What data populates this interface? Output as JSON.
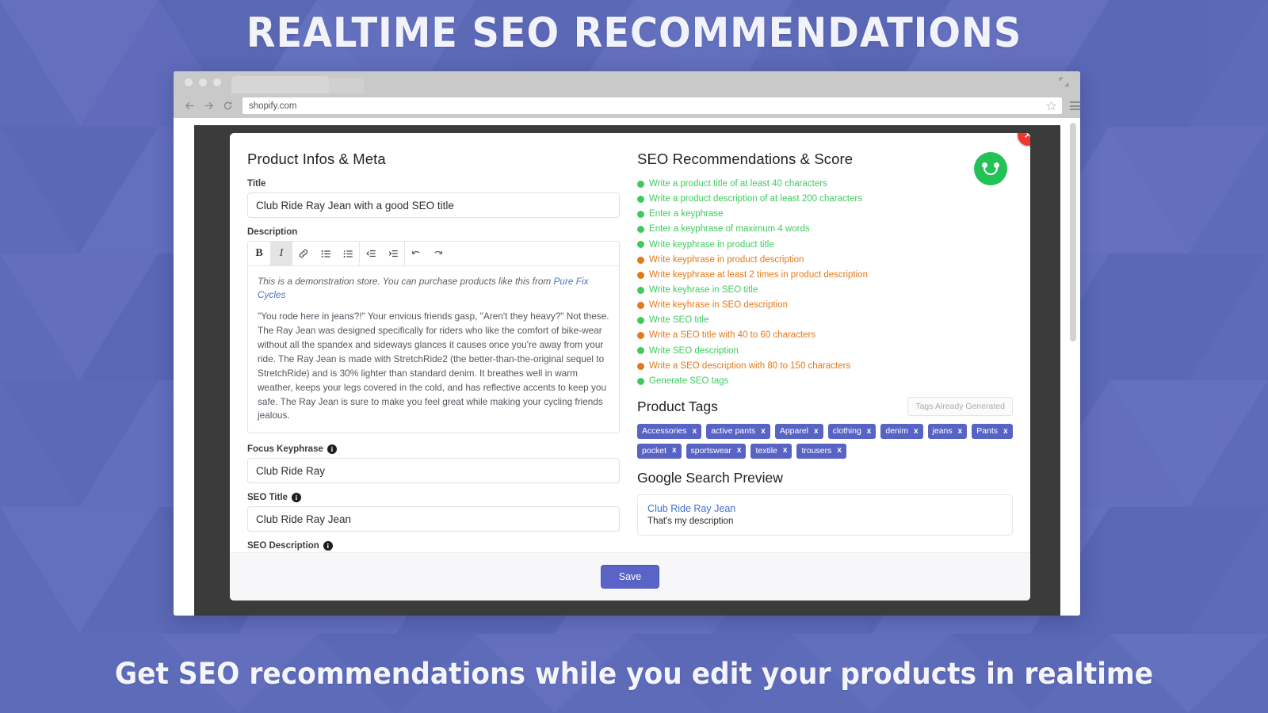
{
  "banner": {
    "headline": "REALTIME SEO RECOMMENDATIONS",
    "caption": "Get SEO recommendations while you edit your products in realtime"
  },
  "colors": {
    "background": "#5e6bb9",
    "ok": "#3ecb5e",
    "warn": "#e2791a",
    "accent": "#5864c4",
    "danger": "#f1352f",
    "smiley": "#24c156"
  },
  "browser": {
    "url": "shopify.com",
    "icons": [
      "back-arrow-icon",
      "forward-arrow-icon",
      "reload-icon",
      "star-icon",
      "hamburger-menu-icon",
      "maximize-icon"
    ]
  },
  "modal": {
    "close_label": "✕",
    "left": {
      "panel_title": "Product Infos & Meta",
      "title_label": "Title",
      "title_value": "Club Ride Ray Jean with a good SEO title",
      "description_label": "Description",
      "toolbar": [
        {
          "name": "bold",
          "glyph": "B"
        },
        {
          "name": "italic",
          "glyph": "I"
        },
        {
          "name": "link",
          "glyph": "🔗"
        },
        {
          "name": "bulleted-list",
          "glyph": "•≡"
        },
        {
          "name": "numbered-list",
          "glyph": "1≡"
        },
        {
          "name": "outdent",
          "glyph": "⇤"
        },
        {
          "name": "indent",
          "glyph": "⇥"
        },
        {
          "name": "undo",
          "glyph": "↩"
        },
        {
          "name": "redo",
          "glyph": "↪"
        }
      ],
      "editor_intro_before": "This is a demonstration store. You can purchase products like this from ",
      "editor_intro_link": "Pure Fix Cycles",
      "editor_paragraph": "\"You rode here in jeans?!\" Your envious friends gasp, \"Aren't they heavy?\" Not these. The Ray Jean was designed specifically for riders who like the comfort of bike-wear without all the spandex and sideways glances it causes once you're away from your ride. The Ray Jean is made with StretchRide2 (the better-than-the-original sequel to StretchRide) and is 30% lighter than standard denim. It breathes well in warm weather, keeps your legs covered in the cold, and has reflective accents to keep you safe. The Ray Jean is sure to make you feel great while making your cycling friends jealous.",
      "focus_keyphrase_label": "Focus Keyphrase",
      "focus_keyphrase_value": "Club Ride Ray",
      "seo_title_label": "SEO Title",
      "seo_title_value": "Club Ride Ray Jean",
      "seo_description_label": "SEO Description",
      "seo_description_value": "That's my description"
    },
    "right": {
      "panel_title": "SEO Recommendations & Score",
      "recommendations": [
        {
          "text": "Write a product title of at least 40 characters",
          "status": "ok"
        },
        {
          "text": "Write a product description of at least 200 characters",
          "status": "ok"
        },
        {
          "text": "Enter a keyphrase",
          "status": "ok"
        },
        {
          "text": "Enter a keyphrase of maximum 4 words",
          "status": "ok"
        },
        {
          "text": "Write keyphrase in product title",
          "status": "ok"
        },
        {
          "text": "Write keyphrase in product description",
          "status": "warn"
        },
        {
          "text": "Write keyphrase at least 2 times in product description",
          "status": "warn"
        },
        {
          "text": "Write keyhrase in SEO title",
          "status": "ok"
        },
        {
          "text": "Write keyhrase in SEO description",
          "status": "warn"
        },
        {
          "text": "Write SEO title",
          "status": "ok"
        },
        {
          "text": "Write a SEO title with 40 to 60 characters",
          "status": "warn"
        },
        {
          "text": "Write SEO description",
          "status": "ok"
        },
        {
          "text": "Write a SEO description with 80 to 150 characters",
          "status": "warn"
        },
        {
          "text": "Generate SEO tags",
          "status": "ok"
        }
      ],
      "tags_title": "Product Tags",
      "tags_button": "Tags Already Generated",
      "tags": [
        "Accessories",
        "active pants",
        "Apparel",
        "clothing",
        "denim",
        "jeans",
        "Pants",
        "pocket",
        "sportswear",
        "textile",
        "trousers"
      ],
      "tag_remove": "x",
      "preview_title": "Google Search Preview",
      "preview_link": "Club Ride Ray Jean",
      "preview_description": "That's my description"
    },
    "save_label": "Save"
  }
}
